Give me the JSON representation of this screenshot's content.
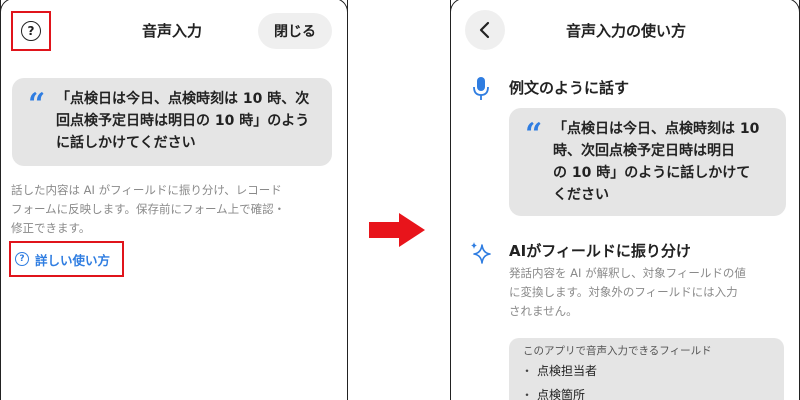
{
  "left_screen": {
    "title": "音声入力",
    "close_label": "閉じる",
    "help_icon_glyph": "?",
    "example_lines": [
      "「点検日は今日、点検時刻は 10 時、次",
      "回点検予定日時は明日の 10 時」のよう",
      "に話しかけてください"
    ],
    "description_lines": [
      "話した内容は AI がフィールドに振り分け、レコード",
      "フォームに反映します。保存前にフォーム上で確認・",
      "修正できます。"
    ],
    "detail_link_label": "詳しい使い方",
    "highlight_color": "#e0141b"
  },
  "right_screen": {
    "title": "音声入力の使い方",
    "section1": {
      "icon": "microphone-icon",
      "title": "例文のように話す",
      "example_lines": [
        "「点検日は今日、点検時刻は 10",
        "時、次回点検予定日時は明日",
        "の 10 時」のように話しかけて",
        "ください"
      ]
    },
    "section2": {
      "icon": "sparkle-icon",
      "title": "AIがフィールドに振り分け",
      "description_lines": [
        "発話内容を AI が解釈し、対象フィールドの値",
        "に変換します。対象外のフィールドには入力",
        "されません。"
      ],
      "fields_heading": "このアプリで音声入力できるフィールド",
      "fields": [
        "点検担当者",
        "点検箇所"
      ]
    }
  },
  "colors": {
    "accent": "#2f7de1",
    "arrow": "#e8141b",
    "quote_bg": "#e5e5e5"
  }
}
